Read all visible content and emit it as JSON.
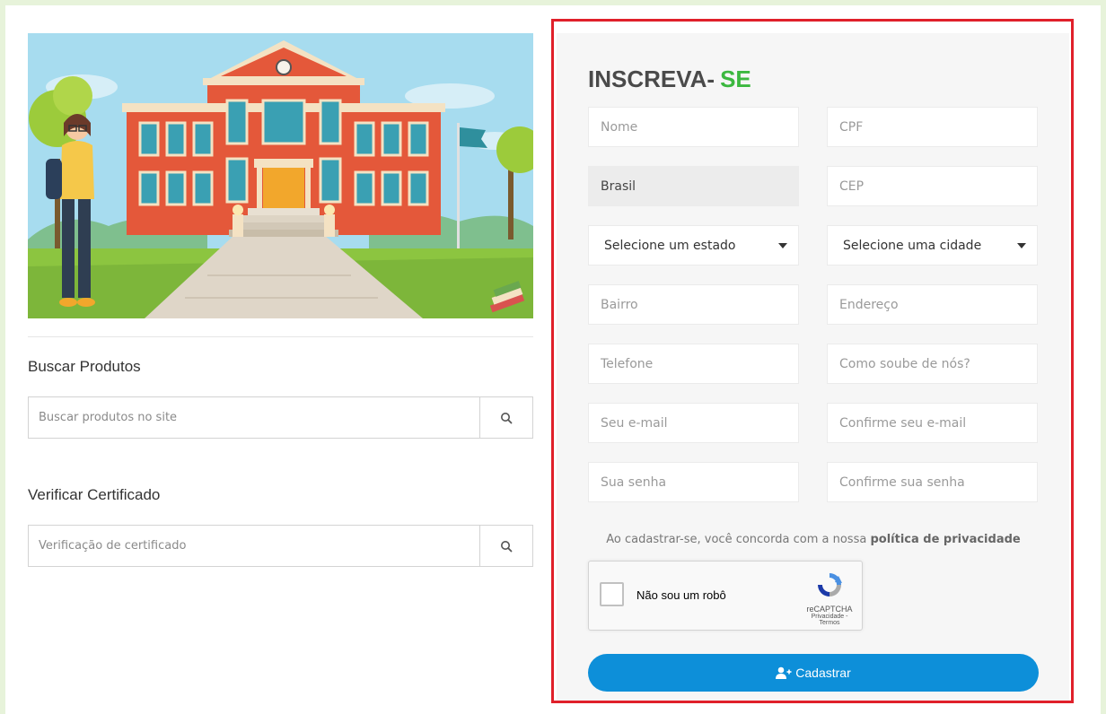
{
  "sidebar": {
    "search_products": {
      "title": "Buscar Produtos",
      "placeholder": "Buscar produtos no site"
    },
    "verify_certificate": {
      "title": "Verificar Certificado",
      "placeholder": "Verificação de certificado"
    }
  },
  "form": {
    "title_main": "INSCREVA-",
    "title_accent": "SE",
    "fields": {
      "nome": "Nome",
      "cpf": "CPF",
      "pais": "Brasil",
      "cep": "CEP",
      "estado": "Selecione um estado",
      "cidade": "Selecione uma cidade",
      "bairro": "Bairro",
      "endereco": "Endereço",
      "telefone": "Telefone",
      "como_soube": "Como soube de nós?",
      "email": "Seu e-mail",
      "email_confirm": "Confirme seu e-mail",
      "senha": "Sua senha",
      "senha_confirm": "Confirme sua senha"
    },
    "consent_prefix": "Ao cadastrar-se, você concorda com a nossa",
    "consent_link": "política de privacidade",
    "captcha": {
      "label": "Não sou um robô",
      "brand": "reCAPTCHA",
      "links": "Privacidade - Termos"
    },
    "submit_label": "Cadastrar"
  },
  "colors": {
    "accent_green": "#3cb83f",
    "button_blue": "#0d8fd9",
    "highlight_red": "#e0202a"
  }
}
